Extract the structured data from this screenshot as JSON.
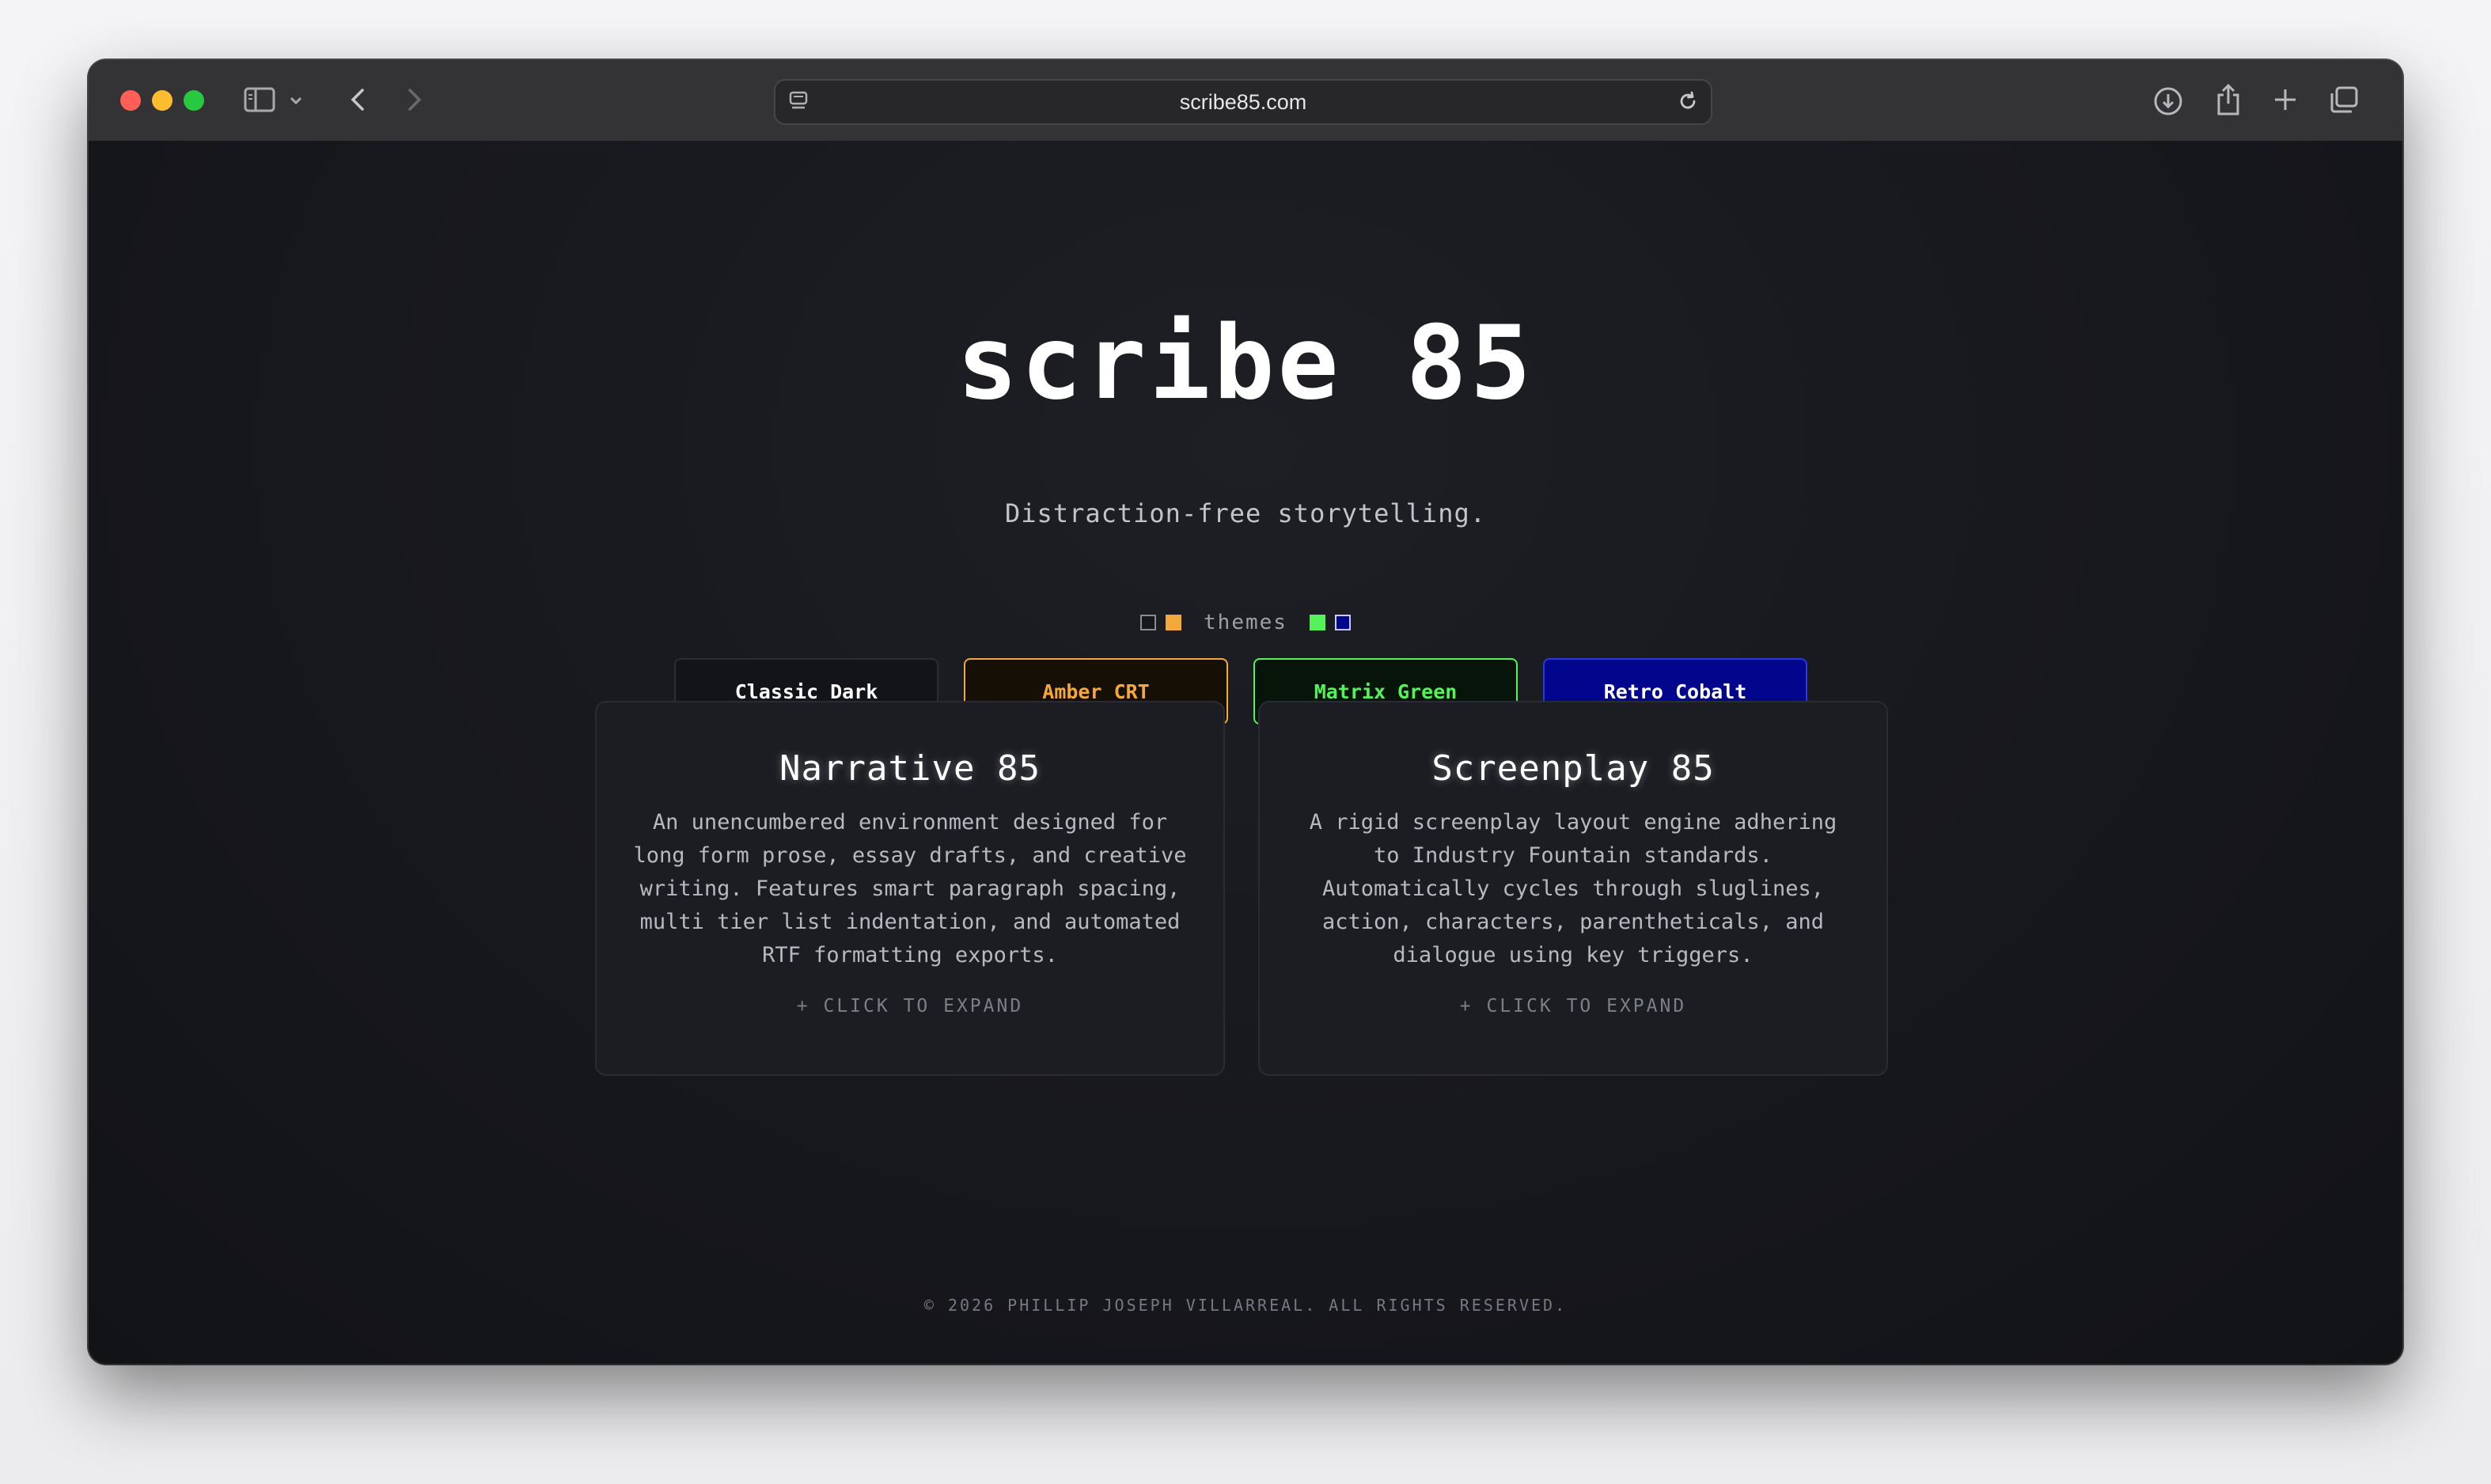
{
  "browser": {
    "url": "scribe85.com"
  },
  "hero": {
    "logo": "scribe 85",
    "tagline": "Distraction-free storytelling."
  },
  "themes": {
    "label": "themes",
    "swatches_left": [
      "#17181d",
      "#f2a83a"
    ],
    "swatches_right": [
      "#56f25b",
      "#01068c"
    ],
    "buttons": [
      {
        "label": "Classic Dark",
        "color": "#ffffff"
      },
      {
        "label": "Amber CRT",
        "color": "#f2a83a"
      },
      {
        "label": "Matrix Green",
        "color": "#56f25b"
      },
      {
        "label": "Retro Cobalt",
        "color": "#ffffff"
      }
    ]
  },
  "cards": [
    {
      "title": "Narrative 85",
      "description": "An unencumbered environment designed for long form prose, essay drafts, and creative writing. Features smart paragraph spacing, multi tier list indentation, and automated RTF formatting exports.",
      "expand": "+ CLICK TO EXPAND"
    },
    {
      "title": "Screenplay 85",
      "description": "A rigid screenplay layout engine adhering to Industry Fountain standards. Automatically cycles through sluglines, action, characters, parentheticals, and dialogue using key triggers.",
      "expand": "+ CLICK TO EXPAND"
    }
  ],
  "footer": {
    "copyright": "© 2026 PHILLIP JOSEPH VILLARREAL. ALL RIGHTS RESERVED."
  }
}
